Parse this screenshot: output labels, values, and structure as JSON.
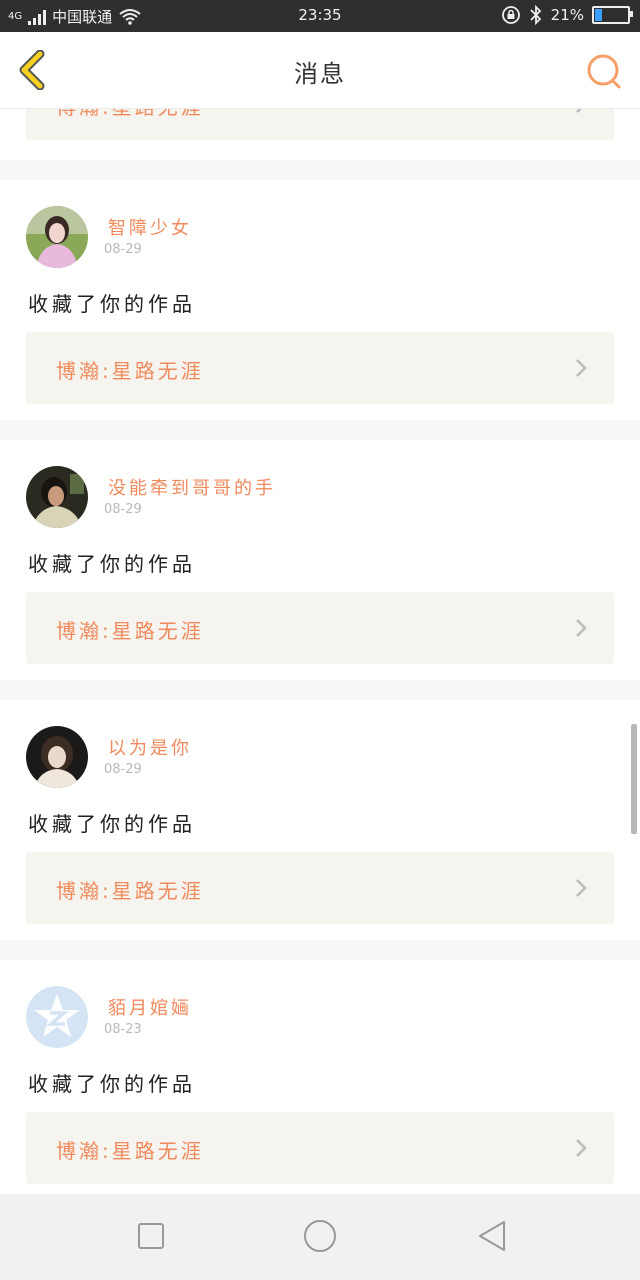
{
  "status_bar": {
    "network": "4G",
    "carrier": "中国联通",
    "time": "23:35",
    "battery": "21%",
    "battery_level": 0.21
  },
  "header": {
    "title": "消息",
    "back_icon": "chevron-left-icon",
    "search_icon": "search-icon"
  },
  "top_partial": {
    "work_title": "博瀚:星路无涯"
  },
  "messages": [
    {
      "username": "智障少女",
      "date": "08-29",
      "action": "收藏了你的作品",
      "work_title": "博瀚:星路无涯"
    },
    {
      "username": "没能牵到哥哥的手",
      "date": "08-29",
      "action": "收藏了你的作品",
      "work_title": "博瀚:星路无涯"
    },
    {
      "username": "以为是你",
      "date": "08-29",
      "action": "收藏了你的作品",
      "work_title": "博瀚:星路无涯"
    },
    {
      "username": "貊月婠婳",
      "date": "08-23",
      "action": "收藏了你的作品",
      "work_title": "博瀚:星路无涯"
    }
  ],
  "nav_bar": {
    "items": [
      "recents-icon",
      "home-icon",
      "back-icon"
    ]
  },
  "colors": {
    "accent": "#f08a5d",
    "header_icon": "#f5a623",
    "status_bar": "#2f2f2f",
    "work_bg": "#f5f4ef"
  }
}
